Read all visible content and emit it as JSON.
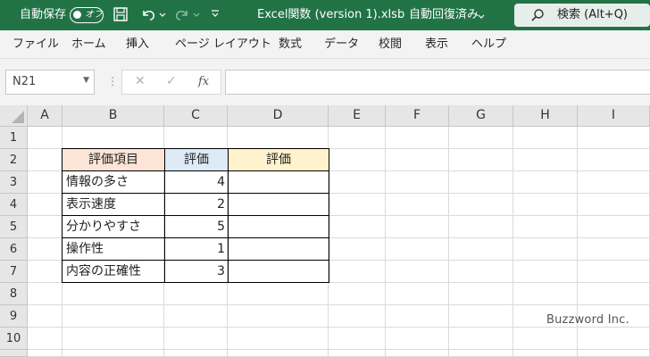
{
  "titlebar": {
    "autosave_label": "自動保存",
    "autosave_state": "オフ",
    "doc_title": "Excel関数 (version 1).xlsb",
    "save_status": "自動回復済み",
    "search_placeholder": "検索 (Alt+Q)",
    "bg_color": "#217346"
  },
  "ribbon": {
    "tabs": [
      "ファイル",
      "ホーム",
      "挿入",
      "ページ レイアウト",
      "数式",
      "データ",
      "校閲",
      "表示",
      "ヘルプ"
    ]
  },
  "formula_bar": {
    "name_box": "N21",
    "formula": ""
  },
  "sheet": {
    "columns": [
      "A",
      "B",
      "C",
      "D",
      "E",
      "F",
      "G",
      "H",
      "I"
    ],
    "rows": [
      "1",
      "2",
      "3",
      "4",
      "5",
      "6",
      "7",
      "8",
      "9",
      "10"
    ],
    "table": {
      "headers": [
        "評価項目",
        "評価",
        "評価"
      ],
      "header_colors": [
        "#fce4d6",
        "#ddebf7",
        "#fff2cc"
      ],
      "items": [
        {
          "label": "情報の多さ",
          "score": "4",
          "result": ""
        },
        {
          "label": "表示速度",
          "score": "2",
          "result": ""
        },
        {
          "label": "分かりやすさ",
          "score": "5",
          "result": ""
        },
        {
          "label": "操作性",
          "score": "1",
          "result": ""
        },
        {
          "label": "内容の正確性",
          "score": "3",
          "result": ""
        }
      ]
    }
  },
  "watermark": "Buzzword Inc."
}
